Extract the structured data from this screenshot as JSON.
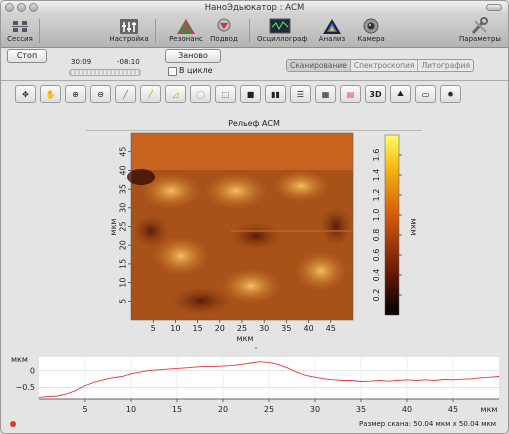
{
  "window": {
    "title": "НаноЭдьюкатор : АСМ"
  },
  "toolbar": {
    "items": [
      {
        "label": "Сессия",
        "icon": "session-icon"
      },
      {
        "label": "Настройка",
        "icon": "tuning-icon"
      },
      {
        "label": "Резонанс",
        "icon": "resonance-icon"
      },
      {
        "label": "Подвод",
        "icon": "approach-icon"
      },
      {
        "label": "Осциллограф",
        "icon": "oscilloscope-icon"
      },
      {
        "label": "Анализ",
        "icon": "analysis-icon"
      },
      {
        "label": "Камера",
        "icon": "camera-icon"
      },
      {
        "label": "Параметры",
        "icon": "parameters-icon"
      }
    ]
  },
  "controls": {
    "stop_label": "Стоп",
    "again_label": "Заново",
    "loop_label": "В цикле",
    "time_elapsed": "30:09",
    "time_remaining": "-08:10",
    "progress": 0.0
  },
  "tabs": [
    "Сканирование",
    "Спектроскопия",
    "Литография"
  ],
  "active_tab": "Сканирование",
  "tools": {
    "items": [
      "pan-icon",
      "hand-icon",
      "zoom-in-icon",
      "zoom-out-icon",
      "pipette-icon",
      "ruler-icon",
      "angle-icon",
      "lasso-icon",
      "select-rect-icon",
      "square-icon",
      "split-vertical-icon",
      "split-horizontal-icon",
      "grid-icon",
      "palette-icon",
      "3d-icon",
      "profile-icon",
      "export-icon",
      "settings-icon"
    ],
    "label_3d": "3D"
  },
  "image_panel": {
    "title": "Рельеф АСМ",
    "x_unit": "мкм",
    "y_unit": "мкм",
    "colorbar_unit": "мкм",
    "x_ticks": [
      "5",
      "10",
      "15",
      "20",
      "25",
      "30",
      "35",
      "40",
      "45"
    ],
    "y_ticks": [
      "5",
      "10",
      "15",
      "20",
      "25",
      "30",
      "35",
      "40",
      "45"
    ],
    "colorbar_ticks": [
      "0.2",
      "0.4",
      "0.6",
      "0.8",
      "1.0",
      "1.2",
      "1.4",
      "1.6"
    ]
  },
  "chart_data": {
    "type": "line",
    "title": "",
    "xlabel": "мкм",
    "ylabel": "мкм",
    "xlim": [
      0,
      50
    ],
    "ylim": [
      -0.85,
      0.4
    ],
    "x_ticks": [
      "5",
      "10",
      "15",
      "20",
      "25",
      "30",
      "35",
      "40",
      "45"
    ],
    "y_ticks": [
      "0",
      "−0.5"
    ],
    "series": [
      {
        "color": "#e8383a",
        "x": [
          0,
          1,
          2,
          3,
          4,
          5,
          6,
          7,
          8,
          9,
          10,
          11,
          12,
          13,
          14,
          15,
          16,
          17,
          18,
          19,
          20,
          21,
          22,
          23,
          24,
          25,
          26,
          27,
          28,
          29,
          30,
          31,
          32,
          33,
          34,
          35,
          36,
          37,
          38,
          39,
          40,
          41,
          42,
          43,
          44,
          45,
          46,
          47,
          48,
          49,
          50
        ],
        "y": [
          -0.8,
          -0.78,
          -0.76,
          -0.7,
          -0.6,
          -0.45,
          -0.35,
          -0.28,
          -0.22,
          -0.18,
          -0.1,
          -0.05,
          0.0,
          0.02,
          0.04,
          0.06,
          0.08,
          0.1,
          0.12,
          0.12,
          0.13,
          0.15,
          0.18,
          0.22,
          0.26,
          0.24,
          0.18,
          0.08,
          -0.05,
          -0.15,
          -0.2,
          -0.25,
          -0.28,
          -0.3,
          -0.3,
          -0.33,
          -0.32,
          -0.3,
          -0.32,
          -0.3,
          -0.28,
          -0.3,
          -0.28,
          -0.3,
          -0.27,
          -0.28,
          -0.26,
          -0.25,
          -0.22,
          -0.2,
          -0.18
        ]
      }
    ]
  },
  "status": {
    "scan_size": "Размер скана: 50.04 мкм x 50.04 мкм"
  }
}
